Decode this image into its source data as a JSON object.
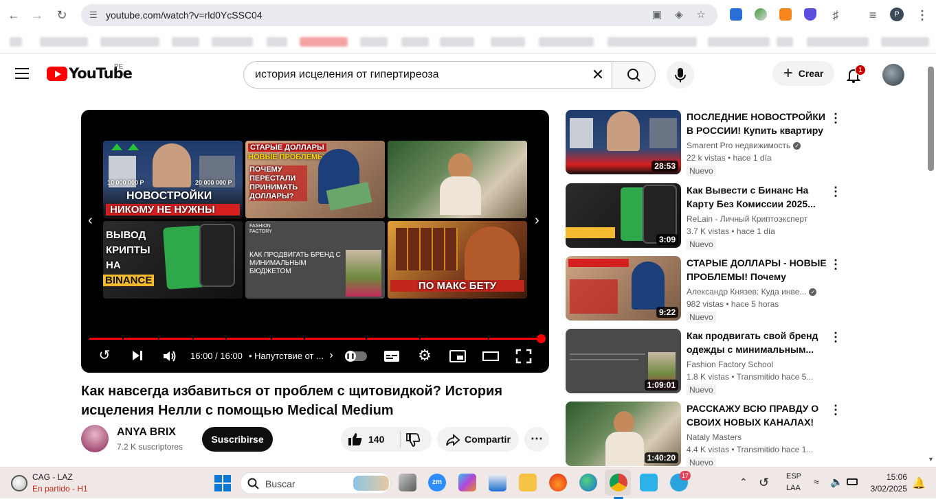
{
  "browser": {
    "url": "youtube.com/watch?v=rld0YcSSC04",
    "profile_initial": "P"
  },
  "header": {
    "logo_text": "YouTube",
    "country": "PE",
    "search_query": "история исцеления от гипертиреоза",
    "create_label": "Crear",
    "notifications_count": "1"
  },
  "player": {
    "time": "16:00 / 16:00",
    "chapter": "• Напутствие от ...",
    "endscreen": {
      "tile1_line1": "НОВОСТРОЙКИ",
      "tile1_line2": "НИКОМУ НЕ НУЖНЫ",
      "tile1_price_left": "10 000 000 Р",
      "tile1_price_right": "20 000 000 Р",
      "tile2_line1": "СТАРЫЕ ДОЛЛАРЫ",
      "tile2_line2": "НОВЫЕ ПРОБЛЕМЫ",
      "tile2_q": "ПОЧЕМУ ПЕРЕСТАЛИ ПРИНИМАТЬ ДОЛЛАРЫ?",
      "tile4_text": "ВЫВОД КРИПТЫ НА КАРТУ",
      "tile4_brand": "BINANCE",
      "tile5_brand": "FASHION FACTORY",
      "tile5_text": "КАК ПРОДВИГАТЬ БРЕНД С МИНИМАЛЬНЫМ БЮДЖЕТОМ",
      "tile6_text": "ПО МАКС БЕТУ"
    }
  },
  "video": {
    "title": "Как навсегда избавиться от проблем с щитовидкой? История исцеления Нелли с помощью Medical Medium",
    "channel": "ANYA BRIX",
    "subscribers": "7.2 K suscriptores",
    "subscribe_label": "Suscribirse",
    "likes": "140",
    "share_label": "Compartir"
  },
  "recommendations": [
    {
      "title": "ПОСЛЕДНИЕ НОВОСТРОЙКИ В РОССИИ! Купить квартиру ...",
      "channel": "Smarent Pro недвижимость",
      "verified": true,
      "meta": "22 k vistas  •  hace 1 día",
      "badge": "Nuevo",
      "duration": "28:53"
    },
    {
      "title": "Как Вывести с Бинанс На Карту Без Комиссии 2025...",
      "channel": "ReLain - Личный Криптоэксперт",
      "verified": false,
      "meta": "3.7 K vistas  •  hace 1 día",
      "badge": "Nuevo",
      "duration": "3:09"
    },
    {
      "title": "СТАРЫЕ ДОЛЛАРЫ - НОВЫЕ ПРОБЛЕМЫ! Почему старые...",
      "channel": "Александр Князев: Куда инве...",
      "verified": true,
      "meta": "982 vistas  •  hace 5 horas",
      "badge": "Nuevo",
      "duration": "9:22"
    },
    {
      "title": "Как продвигать свой бренд одежды с минимальным...",
      "channel": "Fashion Factory School",
      "verified": false,
      "meta": "1.8 K vistas  •  Transmitido hace 5...",
      "badge": "Nuevo",
      "duration": "1:09:01"
    },
    {
      "title": "РАССКАЖУ ВСЮ ПРАВДУ О СВОИХ НОВЫХ КАНАЛАХ! 🔥",
      "channel": "Nataly Masters",
      "verified": false,
      "meta": "4.4 K vistas  •  Transmitido hace 1...",
      "badge": "Nuevo",
      "duration": "1:40:20"
    }
  ],
  "taskbar": {
    "weather_line1": "CAG - LAZ",
    "weather_line2": "En partido - H1",
    "search_label": "Buscar",
    "telegram_badge": "17",
    "lang1": "ESP",
    "lang2": "LAA",
    "time": "15:06",
    "date": "3/02/2025"
  },
  "colors": {
    "accent": "#ff0000",
    "taskbar_bg": "#f0e8e6"
  }
}
